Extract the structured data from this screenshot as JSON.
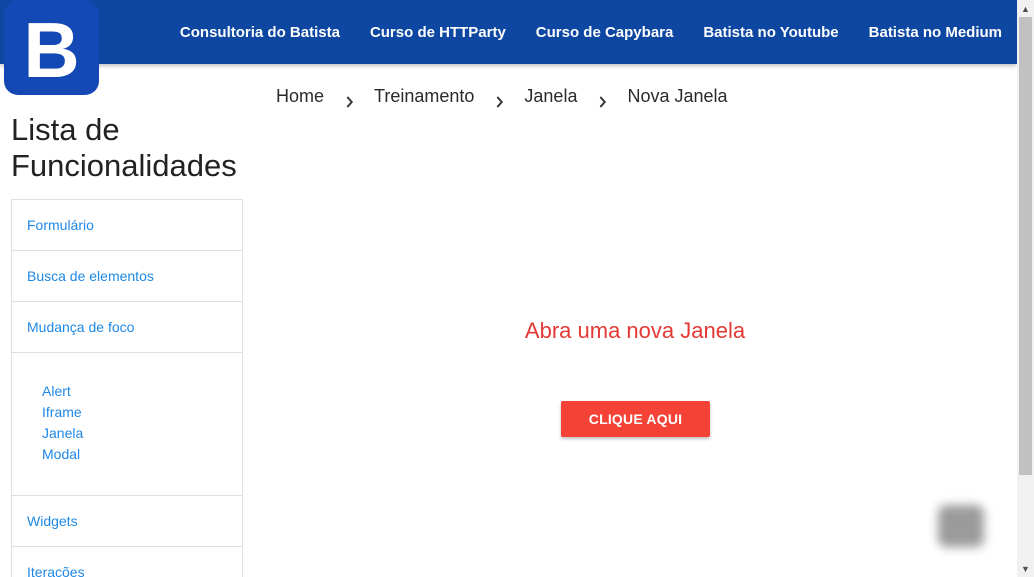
{
  "logo": {
    "letter": "B"
  },
  "nav": {
    "links": [
      "Consultoria do Batista",
      "Curso de HTTParty",
      "Curso de Capybara",
      "Batista no Youtube",
      "Batista no Medium"
    ]
  },
  "breadcrumb": [
    "Home",
    "Treinamento",
    "Janela",
    "Nova Janela"
  ],
  "sidebar": {
    "title": "Lista de Funcionalidades",
    "items": [
      "Formulário",
      "Busca de elementos",
      "Mudança de foco"
    ],
    "sub_items": [
      "Alert",
      "Iframe",
      "Janela",
      "Modal"
    ],
    "items_after": [
      "Widgets",
      "Iterações"
    ]
  },
  "main": {
    "heading": "Abra uma nova Janela",
    "button_label": "CLIQUE AQUI"
  },
  "colors": {
    "navbar": "#0d47a1",
    "link": "#1e88e5",
    "heading": "#e53935",
    "button": "#f44336"
  }
}
